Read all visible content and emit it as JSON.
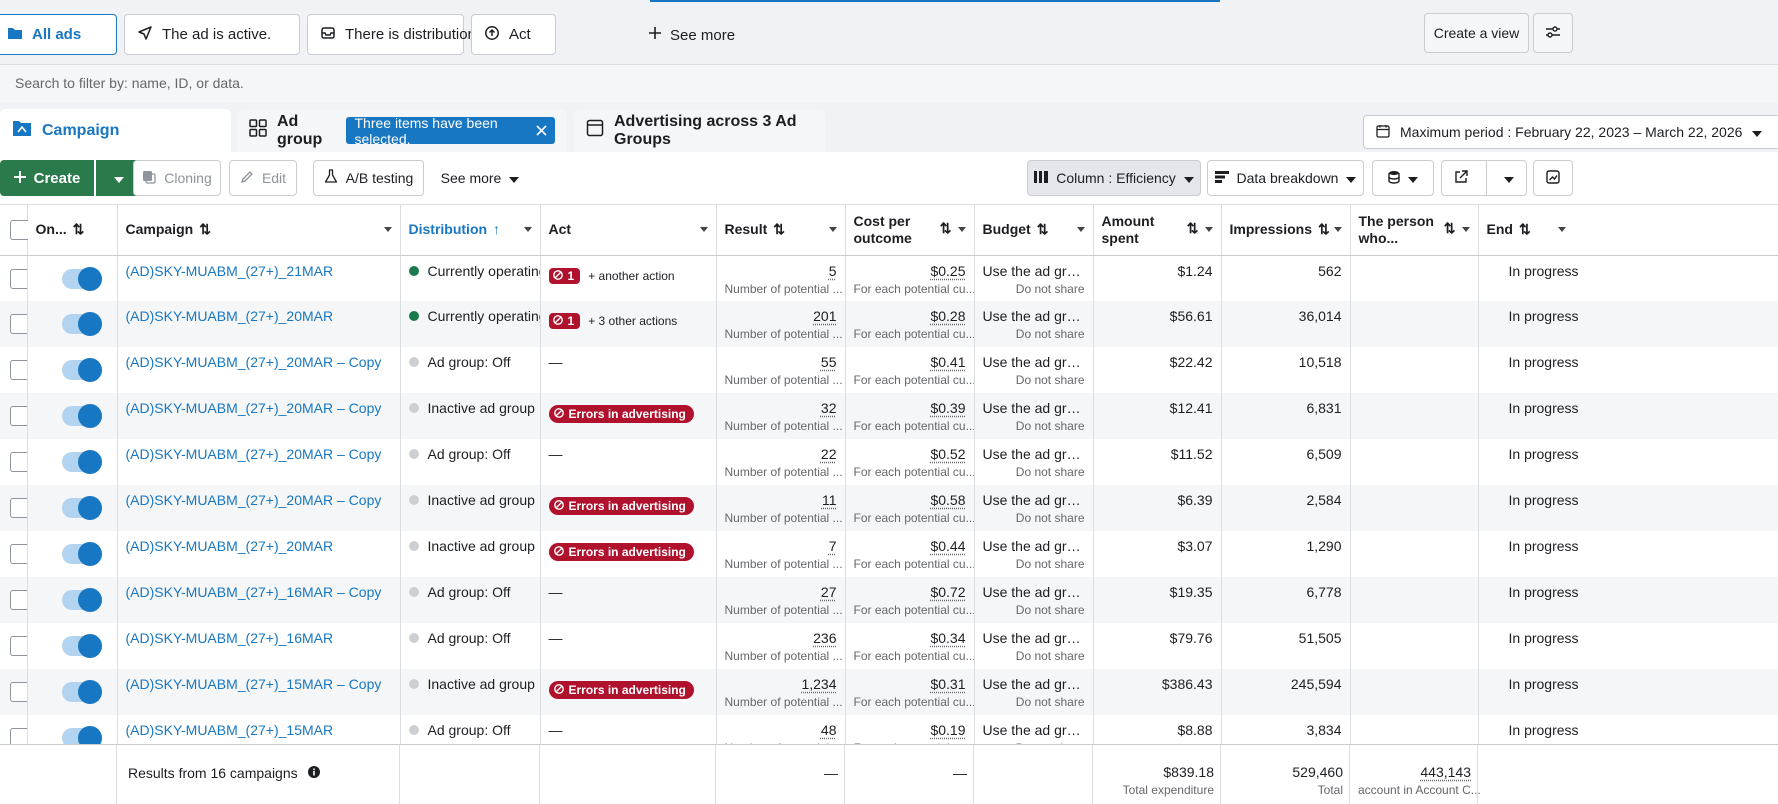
{
  "filter_tabs": [
    {
      "label": "All ads",
      "icon": "folder-icon"
    },
    {
      "label": "The ad is active.",
      "icon": "send-icon"
    },
    {
      "label": "There is distribution",
      "icon": "inbox-icon"
    },
    {
      "label": "Act",
      "icon": "arrow-circle-icon"
    }
  ],
  "see_more_filters": "See more",
  "create_view": "Create a view",
  "search": {
    "placeholder": "Search to filter by: name, ID, or data."
  },
  "levels": {
    "campaign": "Campaign",
    "ad_group": "Ad group",
    "selected_pill": "Three items have been selected.",
    "ads": "Advertising across 3 Ad Groups"
  },
  "date_range": "Maximum period : February 22, 2023 – March 22, 2026",
  "toolbar": {
    "create": "Create",
    "cloning": "Cloning",
    "edit": "Edit",
    "ab_testing": "A/B testing",
    "see_more": "See more",
    "columns": "Column : Efficiency",
    "breakdown": "Data breakdown"
  },
  "columns": {
    "on": "On...",
    "campaign": "Campaign",
    "distribution": "Distribution",
    "act": "Act",
    "result": "Result",
    "cost_line1": "Cost per",
    "cost_line2": "outcome",
    "budget": "Budget",
    "amount_line1": "Amount",
    "amount_line2": "spent",
    "impressions": "Impressions",
    "person_line1": "The person",
    "person_line2": "who...",
    "end": "End"
  },
  "rows": [
    {
      "campaign": "(AD)SKY-MUABM_(27+)_21MAR",
      "distribution": "Currently operating",
      "dist_status": "active",
      "act_type": "count",
      "act_count": "1",
      "act_more": "+ another action",
      "result": "5",
      "result_sub": "Number of potential ...",
      "cost": "$0.25",
      "cost_sub": "For each potential cu...",
      "budget": "Use the ad grou...",
      "budget_sub": "Do not share",
      "spent": "$1.24",
      "impressions": "562",
      "end": "In progress"
    },
    {
      "campaign": "(AD)SKY-MUABM_(27+)_20MAR",
      "distribution": "Currently operating",
      "dist_status": "active",
      "act_type": "count",
      "act_count": "1",
      "act_more": "+ 3 other actions",
      "result": "201",
      "result_sub": "Number of potential ...",
      "cost": "$0.28",
      "cost_sub": "For each potential cu...",
      "budget": "Use the ad grou...",
      "budget_sub": "Do not share",
      "spent": "$56.61",
      "impressions": "36,014",
      "end": "In progress"
    },
    {
      "campaign": "(AD)SKY-MUABM_(27+)_20MAR – Copy",
      "distribution": "Ad group: Off",
      "dist_status": "off",
      "act_type": "dash",
      "act_dash": "—",
      "result": "55",
      "result_sub": "Number of potential ...",
      "cost": "$0.41",
      "cost_sub": "For each potential cu...",
      "budget": "Use the ad grou...",
      "budget_sub": "Do not share",
      "spent": "$22.42",
      "impressions": "10,518",
      "end": "In progress"
    },
    {
      "campaign": "(AD)SKY-MUABM_(27+)_20MAR – Copy",
      "distribution": "Inactive ad group",
      "dist_status": "off",
      "act_type": "error",
      "act_error": "Errors in advertising",
      "result": "32",
      "result_sub": "Number of potential ...",
      "cost": "$0.39",
      "cost_sub": "For each potential cu...",
      "budget": "Use the ad grou...",
      "budget_sub": "Do not share",
      "spent": "$12.41",
      "impressions": "6,831",
      "end": "In progress"
    },
    {
      "campaign": "(AD)SKY-MUABM_(27+)_20MAR – Copy",
      "distribution": "Ad group: Off",
      "dist_status": "off",
      "act_type": "dash",
      "act_dash": "—",
      "result": "22",
      "result_sub": "Number of potential ...",
      "cost": "$0.52",
      "cost_sub": "For each potential cu...",
      "budget": "Use the ad grou...",
      "budget_sub": "Do not share",
      "spent": "$11.52",
      "impressions": "6,509",
      "end": "In progress"
    },
    {
      "campaign": "(AD)SKY-MUABM_(27+)_20MAR – Copy",
      "distribution": "Inactive ad group",
      "dist_status": "off",
      "act_type": "error",
      "act_error": "Errors in advertising",
      "result": "11",
      "result_sub": "Number of potential ...",
      "cost": "$0.58",
      "cost_sub": "For each potential cu...",
      "budget": "Use the ad grou...",
      "budget_sub": "Do not share",
      "spent": "$6.39",
      "impressions": "2,584",
      "end": "In progress"
    },
    {
      "campaign": "(AD)SKY-MUABM_(27+)_20MAR",
      "distribution": "Inactive ad group",
      "dist_status": "off",
      "act_type": "error",
      "act_error": "Errors in advertising",
      "result": "7",
      "result_sub": "Number of potential ...",
      "cost": "$0.44",
      "cost_sub": "For each potential cu...",
      "budget": "Use the ad grou...",
      "budget_sub": "Do not share",
      "spent": "$3.07",
      "impressions": "1,290",
      "end": "In progress"
    },
    {
      "campaign": "(AD)SKY-MUABM_(27+)_16MAR – Copy",
      "distribution": "Ad group: Off",
      "dist_status": "off",
      "act_type": "dash",
      "act_dash": "—",
      "result": "27",
      "result_sub": "Number of potential ...",
      "cost": "$0.72",
      "cost_sub": "For each potential cu...",
      "budget": "Use the ad grou...",
      "budget_sub": "Do not share",
      "spent": "$19.35",
      "impressions": "6,778",
      "end": "In progress"
    },
    {
      "campaign": "(AD)SKY-MUABM_(27+)_16MAR",
      "distribution": "Ad group: Off",
      "dist_status": "off",
      "act_type": "dash",
      "act_dash": "—",
      "result": "236",
      "result_sub": "Number of potential ...",
      "cost": "$0.34",
      "cost_sub": "For each potential cu...",
      "budget": "Use the ad grou...",
      "budget_sub": "Do not share",
      "spent": "$79.76",
      "impressions": "51,505",
      "end": "In progress"
    },
    {
      "campaign": "(AD)SKY-MUABM_(27+)_15MAR – Copy",
      "distribution": "Inactive ad group",
      "dist_status": "off",
      "act_type": "error",
      "act_error": "Errors in advertising",
      "result": "1,234",
      "result_sub": "Number of potential ...",
      "cost": "$0.31",
      "cost_sub": "For each potential cu...",
      "budget": "Use the ad grou...",
      "budget_sub": "Do not share",
      "spent": "$386.43",
      "impressions": "245,594",
      "end": "In progress"
    },
    {
      "campaign": "(AD)SKY-MUABM_(27+)_15MAR",
      "distribution": "Ad group: Off",
      "dist_status": "off",
      "act_type": "dash",
      "act_dash": "—",
      "result": "48",
      "result_sub": "Number of potential ...",
      "cost": "$0.19",
      "cost_sub": "For each potential cu...",
      "budget": "Use the ad grou...",
      "budget_sub": "Do not share",
      "spent": "$8.88",
      "impressions": "3,834",
      "end": "In progress"
    }
  ],
  "footer": {
    "results_label": "Results from 16 campaigns",
    "result_dash": "—",
    "cost_dash": "—",
    "spent": "$839.18",
    "spent_sub": "Total expenditure",
    "impressions": "529,460",
    "impressions_sub": "Total",
    "people": "443,143",
    "people_sub": "account in Account C..."
  },
  "colors": {
    "accent": "#1877c2",
    "create_green": "#2b7a4b",
    "active_dot": "#1a7a4e",
    "off_dot": "#ccd0d5",
    "error_red": "#b0122e"
  }
}
